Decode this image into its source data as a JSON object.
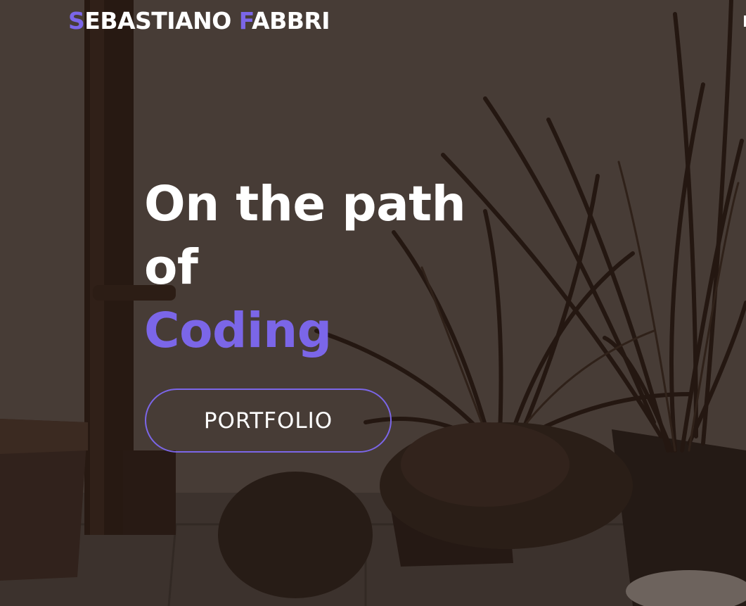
{
  "header": {
    "logo_first_initial": "S",
    "logo_first_rest": "EBASTIANO ",
    "logo_last_initial": "F",
    "logo_last_rest": "ABBRI"
  },
  "hero": {
    "headline_line1": "On the path",
    "headline_line2": "of",
    "headline_line3": "Coding",
    "cta_label": "PORTFOLIO"
  },
  "colors": {
    "accent": "#7b66e8",
    "text": "#ffffff",
    "background_tint": "#4a3f39"
  }
}
